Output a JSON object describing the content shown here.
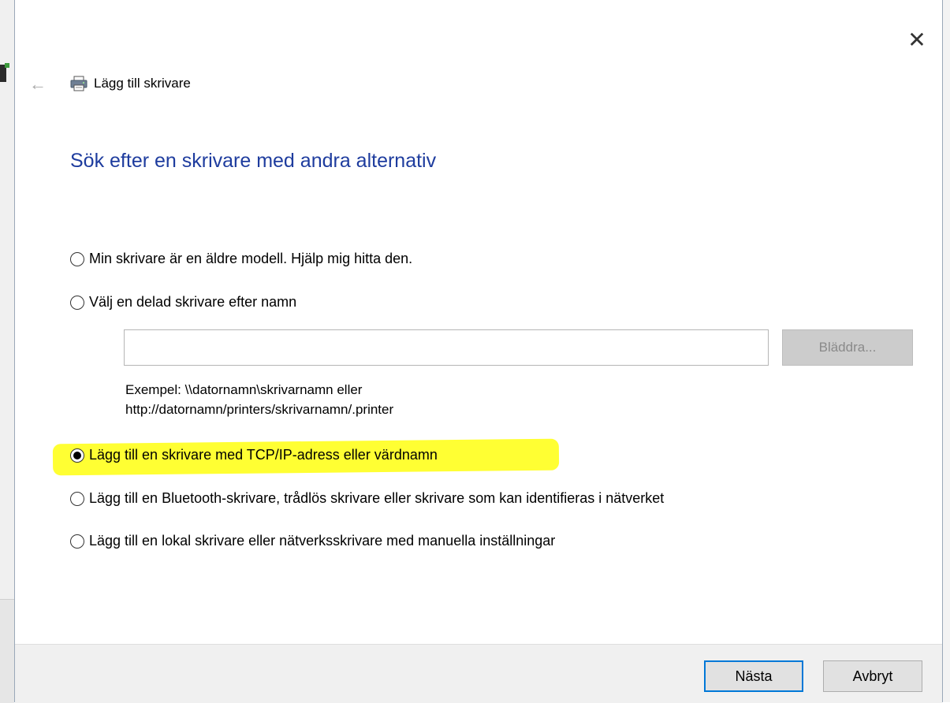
{
  "window": {
    "title": "Lägg till skrivare",
    "close_icon": "close-icon",
    "back_icon": "back-arrow-icon"
  },
  "page": {
    "heading": "Sök efter en skrivare med andra alternativ"
  },
  "options": [
    {
      "label": "Min skrivare är en äldre modell. Hjälp mig hitta den.",
      "selected": false
    },
    {
      "label": "Välj en delad skrivare efter namn",
      "selected": false
    },
    {
      "label": "Lägg till en skrivare med TCP/IP-adress eller värdnamn",
      "selected": true
    },
    {
      "label": "Lägg till en Bluetooth-skrivare, trådlös skrivare eller skrivare som kan identifieras i nätverket",
      "selected": false
    },
    {
      "label": "Lägg till en lokal skrivare eller nätverksskrivare med manuella inställningar",
      "selected": false
    }
  ],
  "shared_printer": {
    "value": "",
    "browse_label": "Bläddra...",
    "example_line1": "Exempel: \\\\datornamn\\skrivarnamn eller",
    "example_line2": "http://datornamn/printers/skrivarnamn/.printer"
  },
  "footer": {
    "next_label": "Nästa",
    "cancel_label": "Avbryt"
  },
  "colors": {
    "heading": "#1e3c9e",
    "highlight": "#ffff33",
    "focus_border": "#0078d7"
  }
}
